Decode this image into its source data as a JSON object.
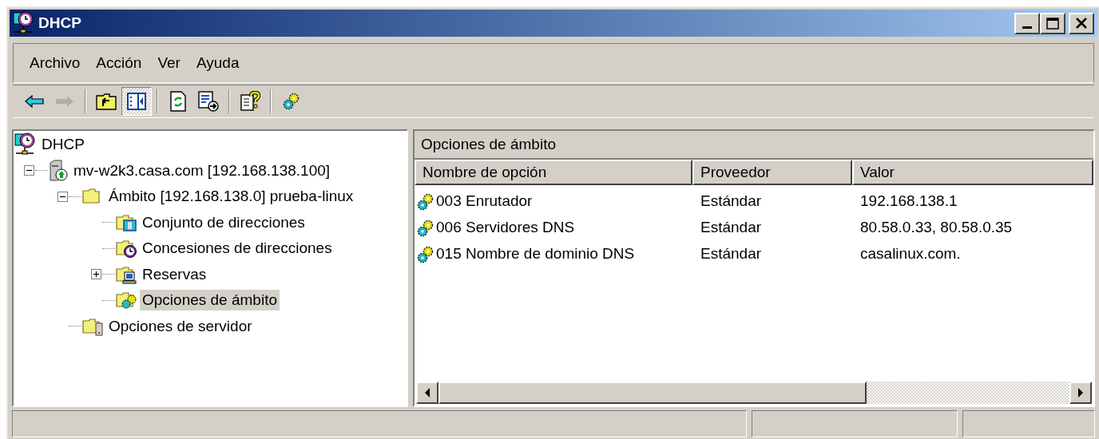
{
  "window": {
    "title": "DHCP"
  },
  "menu": [
    {
      "label": "Archivo"
    },
    {
      "label": "Acción"
    },
    {
      "label": "Ver"
    },
    {
      "label": "Ayuda"
    }
  ],
  "toolbar": [
    {
      "tools": [
        {
          "kind": "back",
          "disabled": false
        },
        {
          "kind": "forward",
          "disabled": true
        }
      ]
    },
    {
      "tools": [
        {
          "kind": "up",
          "disabled": false,
          "pressed": false
        },
        {
          "kind": "tree",
          "disabled": false,
          "pressed": true
        }
      ]
    },
    {
      "tools": [
        {
          "kind": "refresh",
          "disabled": false
        },
        {
          "kind": "export",
          "disabled": false
        }
      ]
    },
    {
      "tools": [
        {
          "kind": "help",
          "disabled": false
        }
      ]
    },
    {
      "tools": [
        {
          "kind": "gears",
          "disabled": false
        }
      ]
    }
  ],
  "tree": [
    {
      "label": "DHCP",
      "kind": "dhcp",
      "selected": false,
      "children": [
        {
          "label": "mv-w2k3.casa.com [192.168.138.100]",
          "kind": "server",
          "selected": false,
          "expanded": true,
          "children": [
            {
              "label": "Ámbito [192.168.138.0] prueba-linux",
              "kind": "folder",
              "selected": false,
              "expanded": true,
              "children": [
                {
                  "label": "Conjunto de direcciones",
                  "kind": "pool",
                  "selected": false
                },
                {
                  "label": "Concesiones de direcciones",
                  "kind": "leases",
                  "selected": false
                },
                {
                  "label": "Reservas",
                  "kind": "reservations",
                  "selected": false,
                  "expanded": false
                },
                {
                  "label": "Opciones de ámbito",
                  "kind": "options",
                  "selected": true
                }
              ]
            },
            {
              "label": "Opciones de servidor",
              "kind": "server-options",
              "selected": false
            }
          ]
        }
      ]
    }
  ],
  "details": {
    "title": "Opciones de ámbito",
    "columns": [
      "Nombre de opción",
      "Proveedor",
      "Valor"
    ],
    "rows": [
      [
        "003 Enrutador",
        "Estándar",
        "192.168.138.1"
      ],
      [
        "006 Servidores DNS",
        "Estándar",
        "80.58.0.33, 80.58.0.35"
      ],
      [
        "015 Nombre de dominio DNS",
        "Estándar",
        "casalinux.com."
      ]
    ]
  }
}
